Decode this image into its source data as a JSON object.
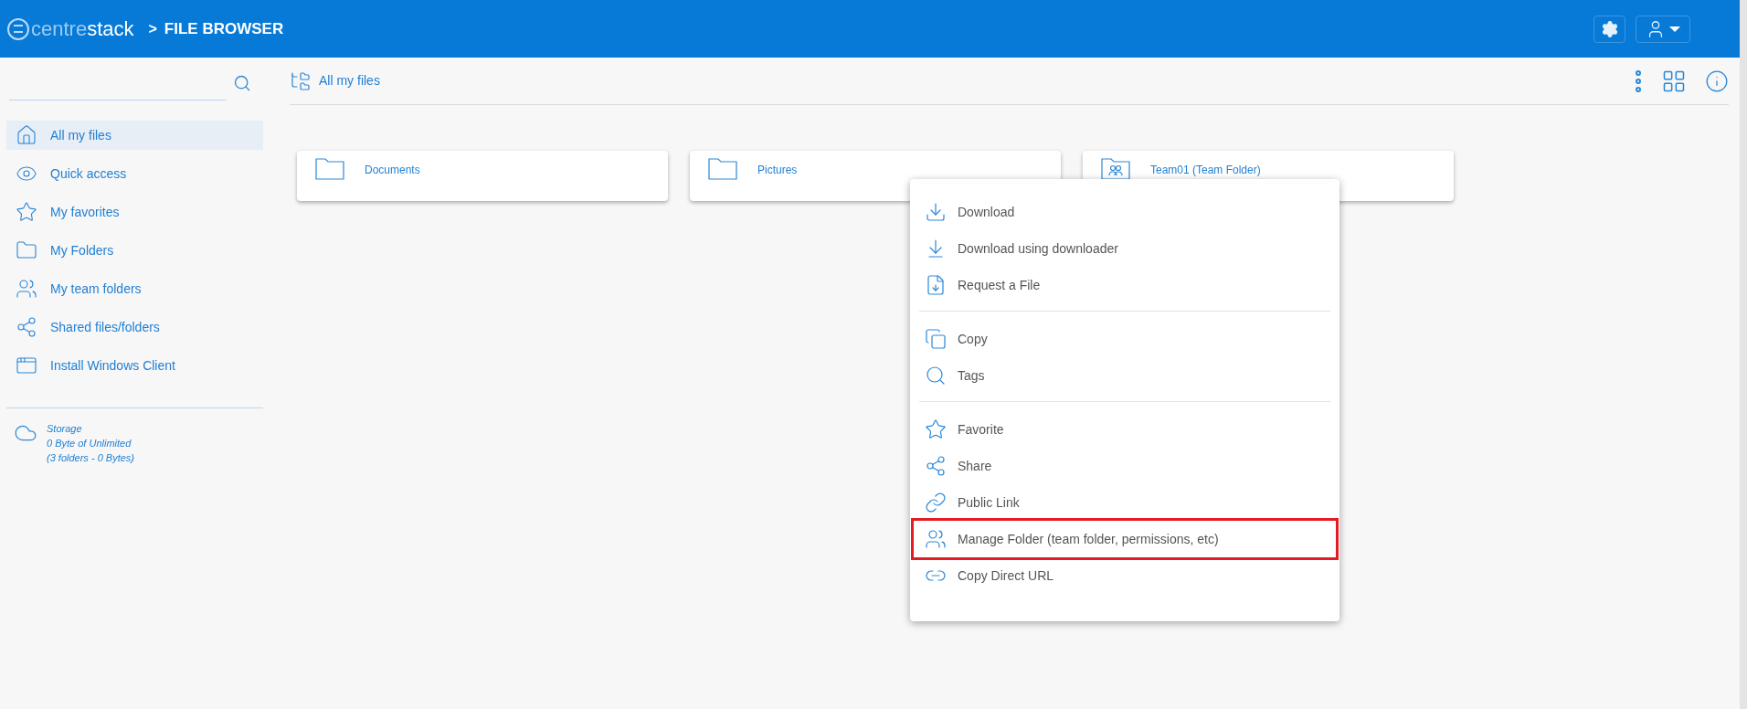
{
  "header": {
    "logo_light": "centre",
    "logo_bold": "stack",
    "separator": ">",
    "title": "FILE BROWSER"
  },
  "sidebar": {
    "items": [
      {
        "label": "All my files",
        "selected": true
      },
      {
        "label": "Quick access",
        "selected": false
      },
      {
        "label": "My favorites",
        "selected": false
      },
      {
        "label": "My Folders",
        "selected": false
      },
      {
        "label": "My team folders",
        "selected": false
      },
      {
        "label": "Shared files/folders",
        "selected": false
      },
      {
        "label": "Install Windows Client",
        "selected": false
      }
    ],
    "storage": {
      "title": "Storage",
      "usage": "0 Byte of Unlimited",
      "summary": "(3 folders - 0 Bytes)"
    }
  },
  "breadcrumb": "All my files",
  "folders": [
    {
      "name": "Documents",
      "kind": "folder"
    },
    {
      "name": "Pictures",
      "kind": "folder"
    },
    {
      "name": "Team01 (Team Folder)",
      "kind": "team"
    }
  ],
  "context_menu": {
    "groups": [
      [
        {
          "label": "Download",
          "highlighted": false
        },
        {
          "label": "Download using downloader",
          "highlighted": false
        },
        {
          "label": "Request a File",
          "highlighted": false
        }
      ],
      [
        {
          "label": "Copy",
          "highlighted": false
        },
        {
          "label": "Tags",
          "highlighted": false
        }
      ],
      [
        {
          "label": "Favorite",
          "highlighted": false
        },
        {
          "label": "Share",
          "highlighted": false
        },
        {
          "label": "Public Link",
          "highlighted": false
        },
        {
          "label": "Manage Folder (team folder, permissions, etc)",
          "highlighted": true
        },
        {
          "label": "Copy Direct URL",
          "highlighted": false
        }
      ]
    ]
  }
}
